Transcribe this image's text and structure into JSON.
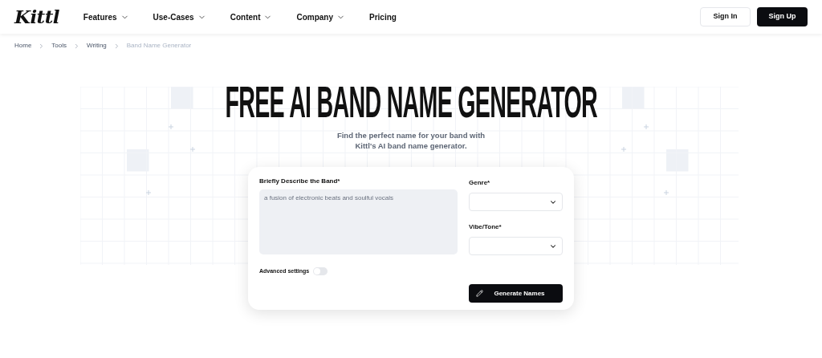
{
  "nav": {
    "logo": "Kittl",
    "menu": [
      {
        "label": "Features",
        "dropdown": true
      },
      {
        "label": "Use-Cases",
        "dropdown": true
      },
      {
        "label": "Content",
        "dropdown": true
      },
      {
        "label": "Company",
        "dropdown": true
      },
      {
        "label": "Pricing",
        "dropdown": false
      }
    ],
    "sign_in": "Sign In",
    "sign_up": "Sign Up"
  },
  "breadcrumbs": [
    {
      "label": "Home",
      "current": false
    },
    {
      "label": "Tools",
      "current": false
    },
    {
      "label": "Writing",
      "current": false
    },
    {
      "label": "Band Name Generator",
      "current": true
    }
  ],
  "title": "FREE AI BAND NAME GENERATOR",
  "subtitle": [
    "Find the perfect name for your band with",
    "Kittl's AI band name generator."
  ],
  "form": {
    "description": {
      "label": "Briefly Describe the Band*",
      "placeholder": "a fusion of electronic beats and soulful vocals"
    },
    "selects": [
      {
        "label": "Genre*"
      },
      {
        "label": "Vibe/Tone*"
      }
    ],
    "advanced": {
      "label": "Advanced settings",
      "on": false
    },
    "submit": "Generate Names"
  }
}
